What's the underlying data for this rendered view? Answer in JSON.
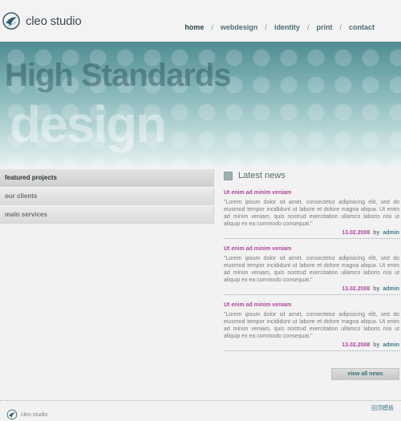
{
  "brand": {
    "name": "cleo studio",
    "footer_name": "cleo studio",
    "colors": {
      "accent": "#b0479c",
      "teal": "#3c7c8b",
      "banner_top": "#4f8c92"
    }
  },
  "topnav": {
    "items": [
      {
        "label": "home",
        "active": true
      },
      {
        "label": "webdesign"
      },
      {
        "label": "identity"
      },
      {
        "label": "print"
      },
      {
        "label": "contact"
      }
    ],
    "separator": "/"
  },
  "banner": {
    "headline": "High Standards",
    "subheadline": "design"
  },
  "sidenav": {
    "items": [
      {
        "label": "featured projects",
        "active": true
      },
      {
        "label": "our clients"
      },
      {
        "label": "main services"
      }
    ]
  },
  "news": {
    "title": "Latest news",
    "by_text": "by",
    "items": [
      {
        "title": "Ut enim ad minim veniam",
        "body": "\"Lorem ipsum dolor sit amet, consectetur adipisicing elit, sed do eiusmod tempor incididunt ut labore et dolore magna aliqua. Ut enim ad minim veniam, quis nostrud exercitation ullamco laboris nisi ut aliquip ex ea commodo consequat.\"",
        "date": "13.02.2008",
        "author": "admin"
      },
      {
        "title": "Ut enim ad minim veniam",
        "body": "\"Lorem ipsum dolor sit amet, consectetur adipisicing elit, sed do eiusmod tempor incididunt ut labore et dolore magna aliqua. Ut enim ad minim veniam, quis nostrud exercitation ullamco laboris nisi ut aliquip ex ea commodo consequat.\"",
        "date": "13.02.2008",
        "author": "admin"
      },
      {
        "title": "Ut enim ad minim veniam",
        "body": "\"Lorem ipsum dolor sit amet, consectetur adipisicing elit, sed do eiusmod tempor incididunt ut labore et dolore magna aliqua. Ut enim ad minim veniam, quis nostrud exercitation ullamco laboris nisi ut aliquip ex ea commodo consequat.\"",
        "date": "13.02.2008",
        "author": "admin"
      }
    ],
    "view_all_label": "view all news"
  },
  "footer": {
    "link_label": "回顶模板"
  }
}
